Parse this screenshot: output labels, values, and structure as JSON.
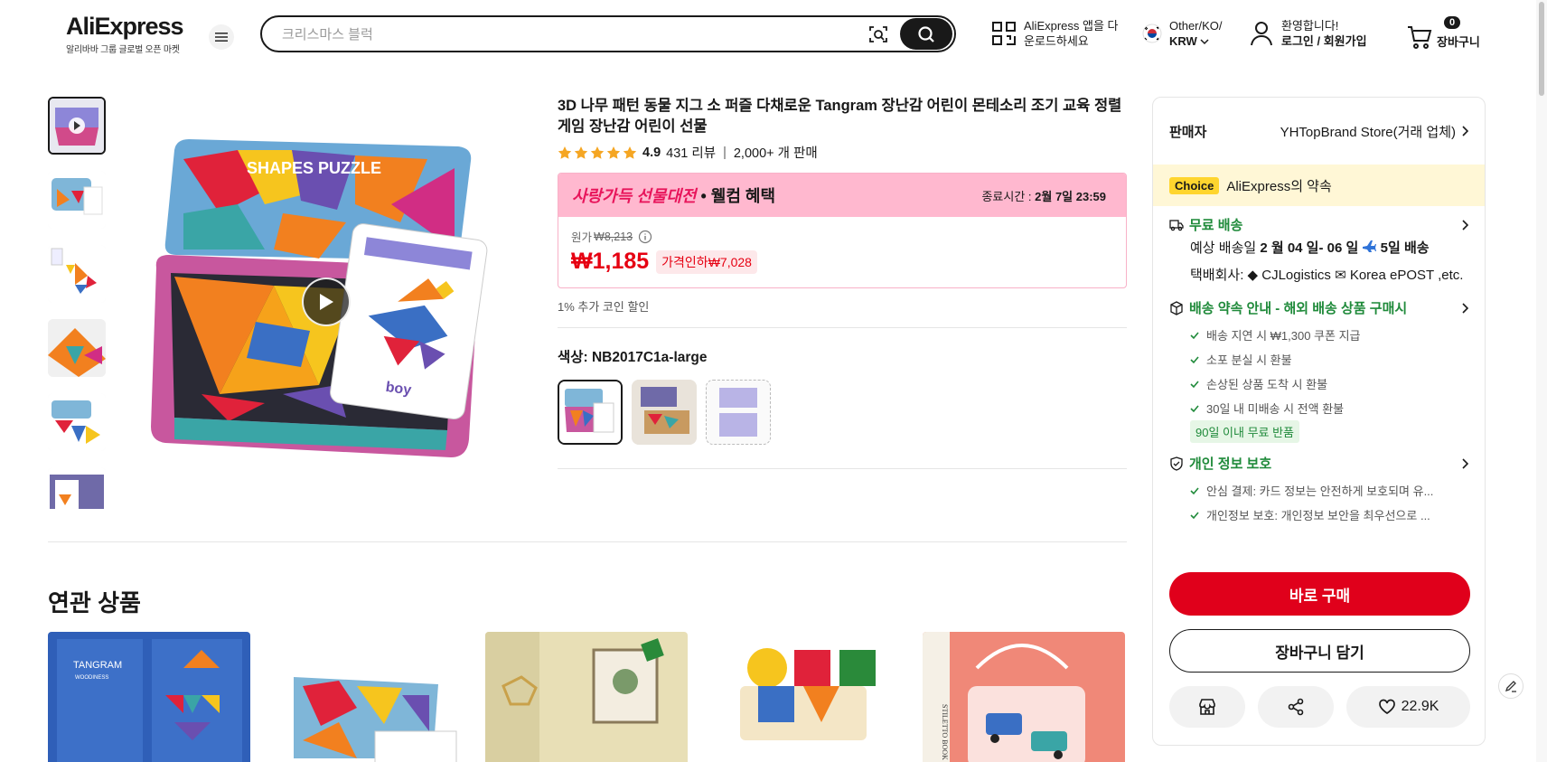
{
  "header": {
    "logo": "AliExpress",
    "logo_sub": "알리바바 그룹 글로벌 오픈 마켓",
    "search_placeholder": "크리스마스 블럭",
    "app_download": "AliExpress 앱을 다운로드하세요",
    "locale_line1": "Other/KO/",
    "locale_line2": "KRW",
    "account_line1": "환영합니다!",
    "account_line2": "로그인 / 회원가입",
    "cart_count": "0",
    "cart_label": "장바구니"
  },
  "product": {
    "title": "3D 나무 패턴 동물 지그 소 퍼즐 다채로운 Tangram 장난감 어린이 몬테소리 조기 교육 정렬 게임 장난감 어린이 선물",
    "rating": "4.9",
    "reviews": "431 리뷰",
    "sold": "2,000+ 개 판매",
    "promo_highlight": "사랑가득 선물대전",
    "promo_rest": "• 웰컴 혜택",
    "promo_time_label": "종료시간 :",
    "promo_time": "2월 7일 23:59",
    "orig_label": "원가",
    "orig_price": "₩8,213",
    "price": "₩1,185",
    "discount": "가격인하₩7,028",
    "coin_note": "1% 추가 코인 할인",
    "color_label": "색상: NB2017C1a-large",
    "image_caption": "boy",
    "box_caption": "SHAPES PUZZLE"
  },
  "related": {
    "title": "연관 상품",
    "card_text": "TANGRAM",
    "card_sub": "WOODINESS",
    "book_text": "STILETTO BOOK"
  },
  "panel": {
    "seller_label": "판매자",
    "seller_name": "YHTopBrand Store(거래 업체)",
    "choice_badge": "Choice",
    "choice_text": "AliExpress의 약속",
    "free_shipping": "무료 배송",
    "eta_prefix": "예상 배송일 ",
    "eta_bold": "2 월 04 일- 06 일",
    "eta_days": "5일 배송",
    "courier": "택배회사: ◆ CJLogistics ✉ Korea ePOST ,etc.",
    "delivery_promise": "배송 약속 안내 - 해외 배송 상품 구매시",
    "delivery_items": [
      "배송 지연 시 ₩1,300 쿠폰 지급",
      "소포 분실 시 환불",
      "손상된 상품 도착 시 환불",
      "30일 내 미배송 시 전액 환불"
    ],
    "return_tag": "90일 이내 무료 반품",
    "privacy": "개인 정보 보호",
    "privacy_items": [
      "안심 결제: 카드 정보는 안전하게 보호되며 유...",
      "개인정보 보호: 개인정보 보안을 최우선으로 ..."
    ],
    "buy_now": "바로 구매",
    "add_cart": "장바구니 담기",
    "likes": "22.9K"
  },
  "colors": {
    "accent_red": "#e60012",
    "choice_yellow": "#ffd52e",
    "green": "#1f8a3a",
    "promo_pink": "#ffb8cf",
    "star": "#f5a623"
  }
}
